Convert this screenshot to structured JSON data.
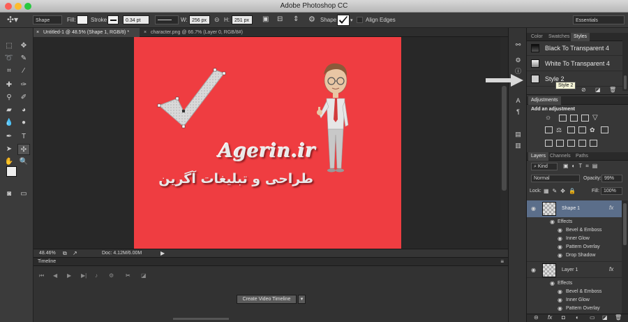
{
  "window": {
    "title": "Adobe Photoshop CC"
  },
  "options_bar": {
    "tool_mode": "Shape",
    "fill_label": "Fill:",
    "stroke_label": "Stroke:",
    "stroke_width": "0.34 pt",
    "w_label": "W:",
    "w_value": "256 px",
    "h_label": "H:",
    "h_value": "251 px",
    "shape_label": "Shape:",
    "align_edges_label": "Align Edges",
    "workspace": "Essentials"
  },
  "documents": {
    "tabs": [
      {
        "label": "Untitled-1 @ 48.5% (Shape 1, RGB/8) *",
        "active": true
      },
      {
        "label": "character.png @ 66.7% (Layer 0, RGB/8#)",
        "active": false
      }
    ],
    "canvas": {
      "brand_text": "Agerin.ir",
      "persian_text": "طراحی و تبلیغات آگرین",
      "background_color": "#ef3d41"
    },
    "status": {
      "zoom": "48.46%",
      "doc": "Doc: 4.12M/6.00M"
    }
  },
  "timeline": {
    "header": "Timeline",
    "create_button": "Create Video Timeline"
  },
  "styles_panel": {
    "tabs": [
      "Color",
      "Swatches",
      "Styles"
    ],
    "items": [
      {
        "label": "Black To Transparent 4"
      },
      {
        "label": "White To Transparent 4"
      },
      {
        "label": "Style 2"
      }
    ],
    "tooltip": "Style 2"
  },
  "adjustments_panel": {
    "tab": "Adjustments",
    "subtitle": "Add an adjustment"
  },
  "layers_panel": {
    "tabs": [
      "Layers",
      "Channels",
      "Paths"
    ],
    "filter_kind": "Kind",
    "blend_mode": "Normal",
    "opacity_label": "Opacity:",
    "opacity_value": "99%",
    "lock_label": "Lock:",
    "fill_label": "Fill:",
    "fill_value": "100%",
    "layers": [
      {
        "name": "Shape 1",
        "fx": "fx",
        "effects_label": "Effects",
        "effects": [
          "Bevel & Emboss",
          "Inner Glow",
          "Pattern Overlay",
          "Drop Shadow"
        ]
      },
      {
        "name": "Layer 1",
        "fx": "fx",
        "effects_label": "Effects",
        "effects": [
          "Bevel & Emboss",
          "Inner Glow",
          "Pattern Overlay"
        ]
      }
    ]
  }
}
